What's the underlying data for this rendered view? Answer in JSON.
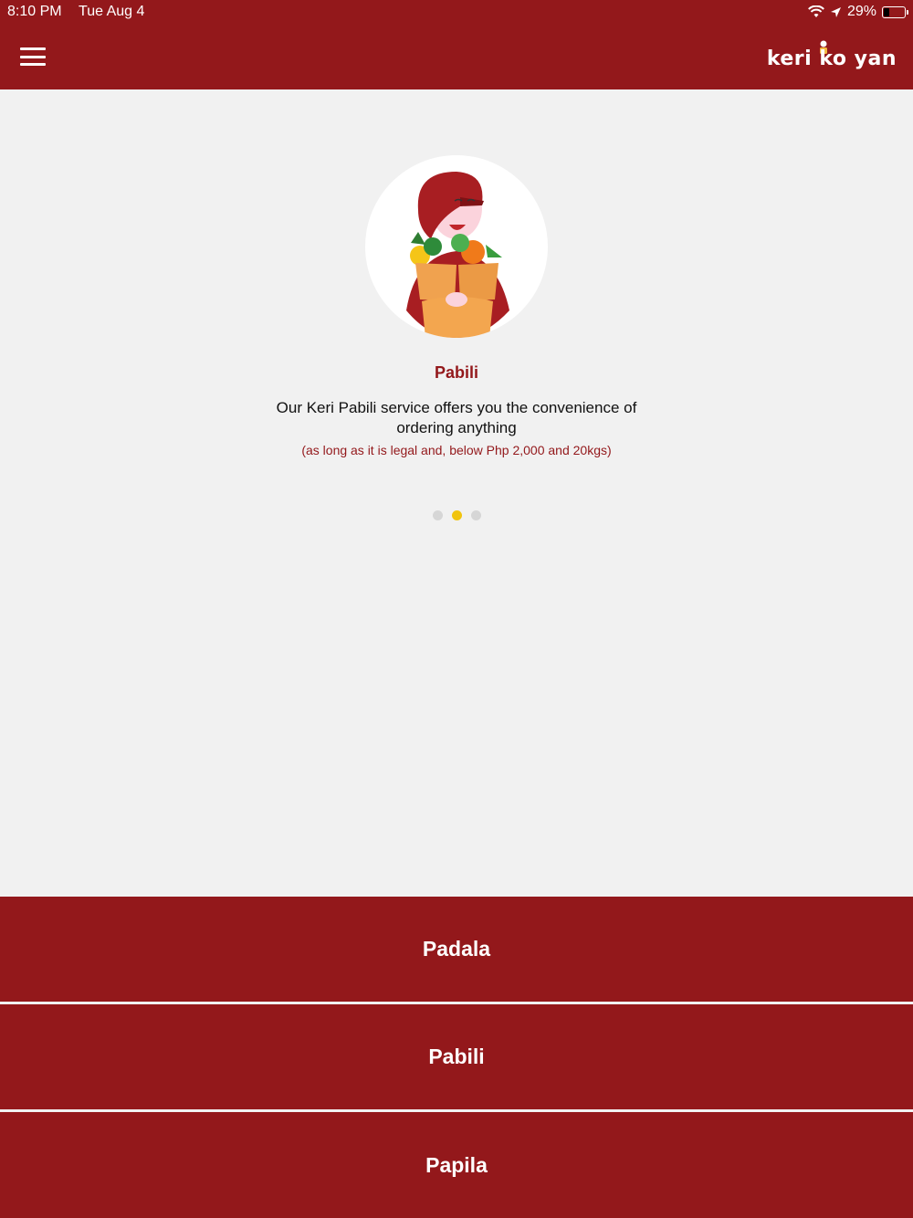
{
  "status_bar": {
    "time": "8:10 PM",
    "date": "Tue Aug 4",
    "battery": "29%",
    "battery_level": 0.29
  },
  "header": {
    "logo_text": "keri ko yan",
    "menu_icon": "hamburger-icon"
  },
  "carousel": {
    "title": "Pabili",
    "description": "Our Keri Pabili service offers you the convenience of ordering anything",
    "note": "(as long as it is legal and, below Php 2,000 and 20kgs)",
    "slides_count": 3,
    "active_index": 1
  },
  "services": [
    {
      "label": "Padala"
    },
    {
      "label": "Pabili"
    },
    {
      "label": "Papila"
    }
  ],
  "colors": {
    "brand": "#93181b",
    "accent": "#f1c40f",
    "background": "#f1f1f1"
  }
}
